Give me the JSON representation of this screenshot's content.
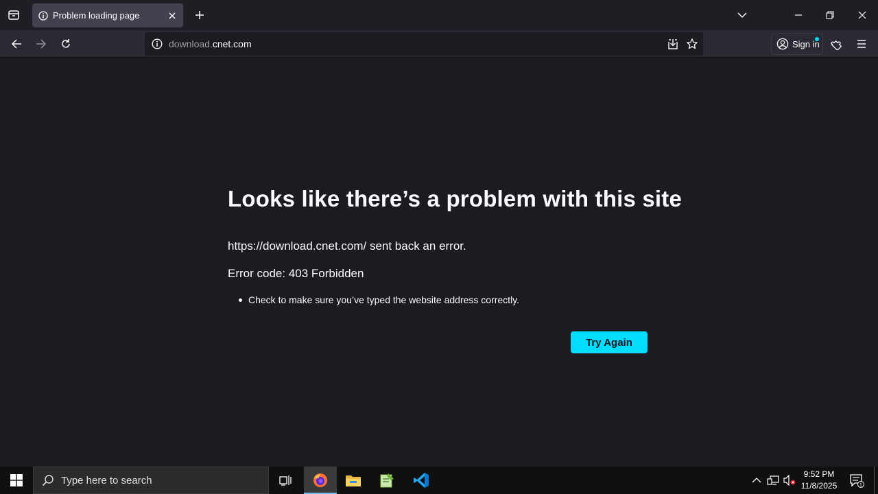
{
  "browser": {
    "tab": {
      "title": "Problem loading page"
    },
    "url": {
      "prefix": "download.",
      "domain": "cnet.com"
    },
    "signin_label": "Sign in"
  },
  "error_page": {
    "title": "Looks like there’s a problem with this site",
    "description": "https://download.cnet.com/ sent back an error.",
    "error_code": "Error code: 403 Forbidden",
    "suggestions": [
      "Check to make sure you’ve typed the website address correctly."
    ],
    "try_again_label": "Try Again"
  },
  "taskbar": {
    "search_placeholder": "Type here to search",
    "apps": [
      "task-view",
      "firefox",
      "file-explorer",
      "notepad-plus-plus",
      "vscode"
    ],
    "clock": {
      "time": "9:52 PM",
      "date": "11/8/2025"
    },
    "notification_count": "1"
  },
  "colors": {
    "accent": "#00ddff",
    "page_bg": "#1c1b22",
    "toolbar_bg": "#2b2a33"
  }
}
